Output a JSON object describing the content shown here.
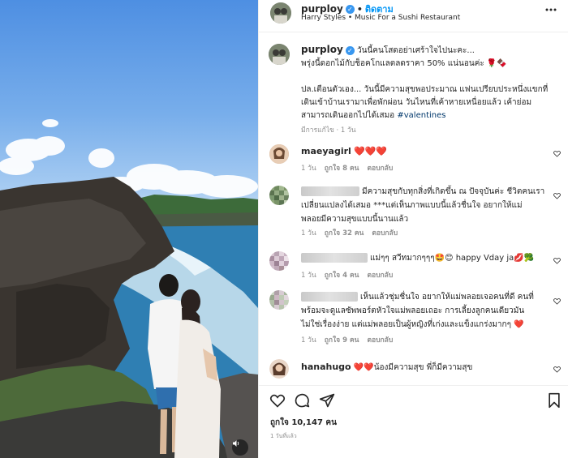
{
  "header": {
    "username": "purploy",
    "separator": "•",
    "follow_label": "ติดตาม",
    "audio": "Harry Styles • Music For a Sushi Restaurant"
  },
  "caption": {
    "username": "purploy",
    "line1": "วันนี้คนโสดอย่าเศร้าใจไปนะคะ...",
    "line2": "พรุ่งนี้ดอกไม้กับช็อคโกแลตลดราคา 50% แน่นอนค่ะ 🌹🍫",
    "line3": "ปล.เตือนตัวเอง... วันนี้มีความสุขพอประมาณ แฟนเปรียบประหนึ่งแขกที่",
    "line4": "เดินเข้าบ้านเรามาเพื่อพักผ่อน วันไหนที่เค้าหายเหนื่อยแล้ว เค้าย่อม",
    "line5": "สามารถเดินออกไปได้เสมอ ",
    "hashtag": "#valentines",
    "edited": "มีการแก้ไข",
    "time": "1 วัน"
  },
  "comments": [
    {
      "username": "maeyagirl",
      "text": "❤️❤️❤️",
      "time": "1 วัน",
      "likes": "ถูกใจ 8 คน",
      "reply": "ตอบกลับ"
    },
    {
      "username": "",
      "text_line1": "มีความสุขกับทุกสิ่งที่เกิดขึ้น ณ ปัจจุบันค่ะ ชีวิตคนเรา",
      "text_line2": "เปลี่ยนแปลงได้เสมอ ***แต่เห็นภาพแบบนี้แล้วชื่นใจ อยากให้แม่",
      "text_line3": "พลอยมีความสุขแบบนี้นานแล้ว",
      "time": "1 วัน",
      "likes": "ถูกใจ 32 คน",
      "reply": "ตอบกลับ"
    },
    {
      "username": "",
      "text": "แม่ๆๆ สวีทมากๆๆๆ🤩😊 happy Vday ja💋🥦",
      "time": "1 วัน",
      "likes": "ถูกใจ 4 คน",
      "reply": "ตอบกลับ"
    },
    {
      "username": "",
      "text_line1": "เห็นแล้วชุ่มชื่นใจ อยากให้แม่พลอยเจอคนที่ดี คนที่",
      "text_line2": "พร้อมจะดูแลซัพพอร์ตหัวใจแม่พลอยเถอะ การเลี้ยงลูกคนเดียวมัน",
      "text_line3": "ไม่ใช่เรื่องง่าย แต่แม่พลอยเป็นผู้หญิงที่เก่งและแข็งแกร่งมากๆ ❤️",
      "time": "1 วัน",
      "likes": "ถูกใจ 9 คน",
      "reply": "ตอบกลับ"
    },
    {
      "username": "hanahugo",
      "text": "❤️❤️น้องมีความสุข พี่ก็มีความสุข"
    }
  ],
  "footer": {
    "likes_label": "ถูกใจ",
    "likes_count": "10,147",
    "likes_suffix": "คน",
    "time": "1 วันที่แล้ว"
  },
  "icons": [
    "heart-icon",
    "comment-icon",
    "share-icon",
    "bookmark-icon",
    "verified-icon",
    "sound-icon"
  ],
  "colors": {
    "accent": "#0095f6",
    "heart": "#ed1c3a",
    "muted": "#8e8e8e",
    "verified": "#3897f0"
  }
}
